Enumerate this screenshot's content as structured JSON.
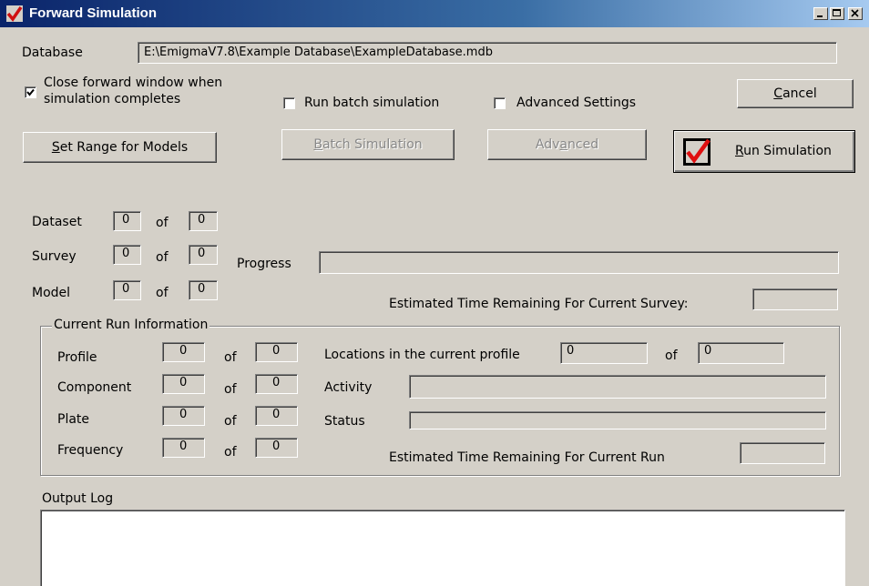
{
  "window": {
    "title": "Forward Simulation"
  },
  "database": {
    "label": "Database",
    "path": "E:\\EmigmaV7.8\\Example Database\\ExampleDatabase.mdb"
  },
  "options": {
    "close_window": {
      "label_line1": "Close forward window when",
      "label_line2": "simulation completes",
      "checked": true
    },
    "run_batch": {
      "label": "Run batch simulation",
      "checked": false
    },
    "advanced_settings": {
      "label": "Advanced Settings",
      "checked": false
    }
  },
  "buttons": {
    "cancel": {
      "underline": "C",
      "rest": "ancel"
    },
    "set_range": {
      "underline": "S",
      "rest": "et Range for Models"
    },
    "batch_simulation": {
      "underline": "B",
      "rest": "atch Simulation"
    },
    "advanced": {
      "prefix": "Adv",
      "underline": "a",
      "rest": "nced"
    },
    "run_simulation": {
      "underline": "R",
      "rest": "un Simulation"
    }
  },
  "counters": {
    "of": "of",
    "dataset": {
      "label": "Dataset",
      "value": "0",
      "total": "0"
    },
    "survey": {
      "label": "Survey",
      "value": "0",
      "total": "0"
    },
    "model": {
      "label": "Model",
      "value": "0",
      "total": "0"
    }
  },
  "progress": {
    "label": "Progress",
    "value": 0
  },
  "eta_survey": {
    "label": "Estimated Time Remaining For Current Survey:",
    "value": ""
  },
  "current_run": {
    "title": "Current Run Information",
    "profile": {
      "label": "Profile",
      "value": "0",
      "total": "0"
    },
    "component": {
      "label": "Component",
      "value": "0",
      "total": "0"
    },
    "plate": {
      "label": "Plate",
      "value": "0",
      "total": "0"
    },
    "frequency": {
      "label": "Frequency",
      "value": "0",
      "total": "0"
    },
    "locations": {
      "label": "Locations in the current profile",
      "value": "0",
      "total": "0"
    },
    "activity": {
      "label": "Activity",
      "value": ""
    },
    "status": {
      "label": "Status",
      "value": ""
    },
    "eta_run": {
      "label": "Estimated Time Remaining For Current Run",
      "value": ""
    }
  },
  "output_log": {
    "label": "Output Log",
    "content": ""
  }
}
